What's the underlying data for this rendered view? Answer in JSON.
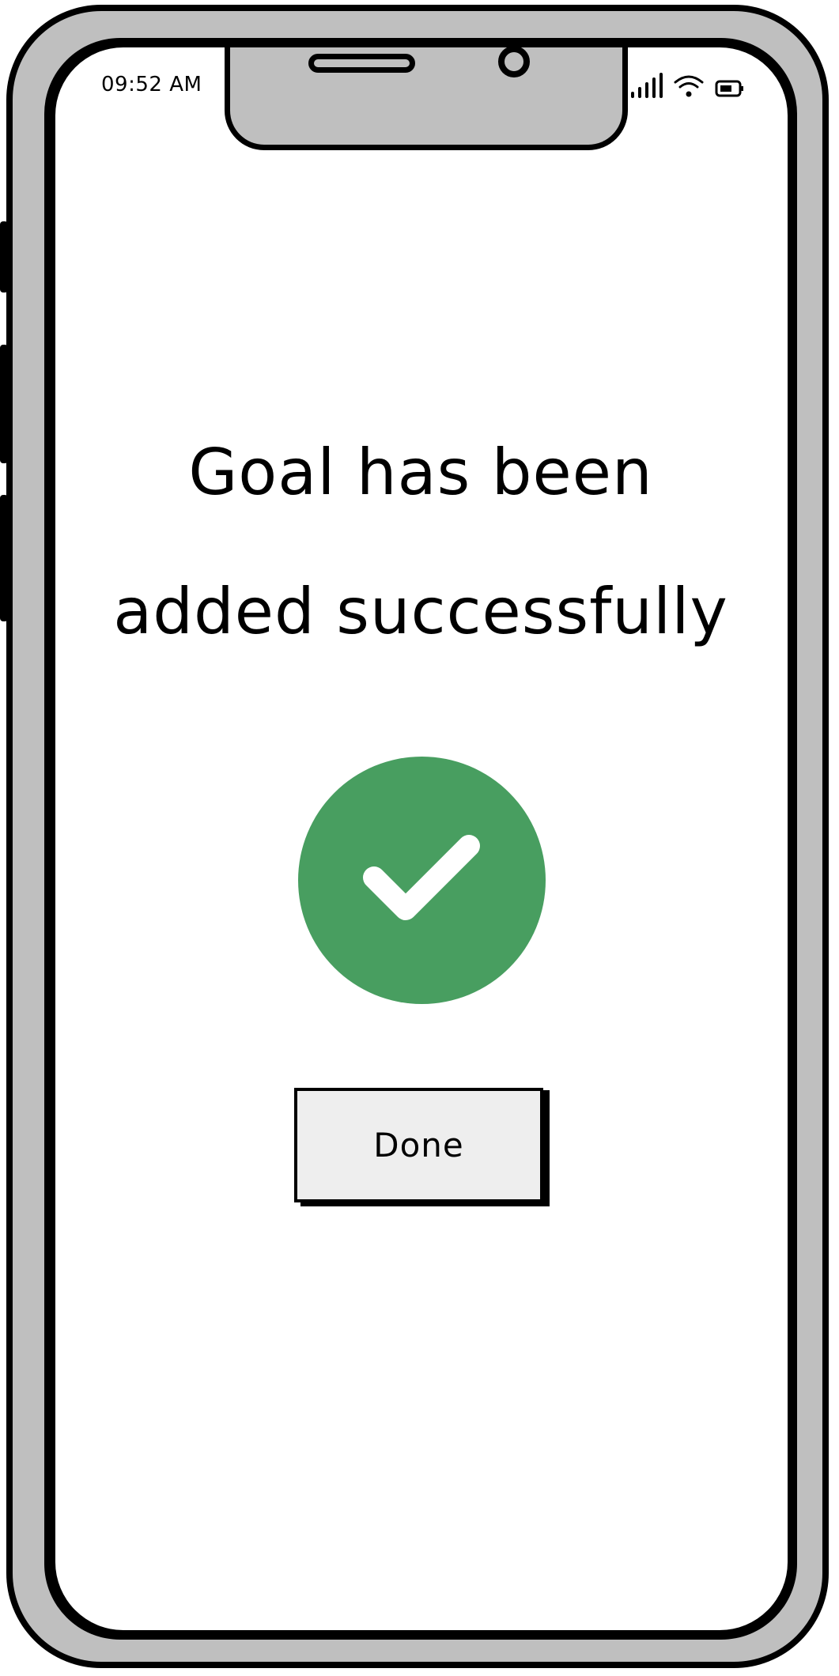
{
  "status_bar": {
    "time": "09:52 AM",
    "icons": [
      "signal-icon",
      "wifi-icon",
      "battery-icon"
    ]
  },
  "confirmation": {
    "headline_line1": "Goal has been",
    "headline_line2": "added successfully",
    "success_icon": "checkmark-icon",
    "done_label": "Done"
  },
  "colors": {
    "success_green": "#489e60",
    "button_bg": "#eeeeee",
    "frame_gray": "#bfbfbf"
  }
}
